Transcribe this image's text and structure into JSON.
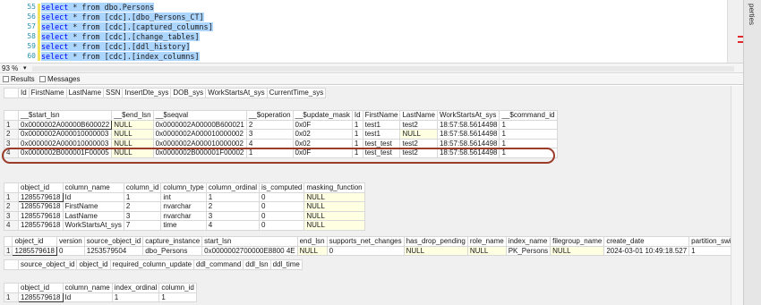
{
  "editor": {
    "lines": [
      {
        "num": "55",
        "kw": "select",
        "rest": " * from dbo.Persons"
      },
      {
        "num": "56",
        "kw": "select",
        "rest": " * from [cdc].[dbo_Persons_CT]"
      },
      {
        "num": "57",
        "kw": "select",
        "rest": " * from [cdc].[captured_columns]"
      },
      {
        "num": "58",
        "kw": "select",
        "rest": " * from [cdc].[change_tables]"
      },
      {
        "num": "59",
        "kw": "select",
        "rest": " * from [cdc].[ddl_history]"
      },
      {
        "num": "60",
        "kw": "select",
        "rest": " * from [cdc].[index_columns]"
      }
    ],
    "zoom": "93 %"
  },
  "tabs": {
    "results": "Results",
    "messages": "Messages"
  },
  "side_panel": {
    "label": "perties"
  },
  "grid1": {
    "headers": [
      "Id",
      "FirstName",
      "LastName",
      "SSN",
      "InsertDte_sys",
      "DOB_sys",
      "WorkStartsAt_sys",
      "CurrentTime_sys"
    ]
  },
  "grid2": {
    "headers": [
      "__$start_lsn",
      "__$end_lsn",
      "__$seqval",
      "__$operation",
      "__$update_mask",
      "Id",
      "FirstName",
      "LastName",
      "WorkStartsAt_sys",
      "__$command_id"
    ],
    "rows": [
      [
        "1",
        "0x0000002A00000B600022",
        "NULL",
        "0x0000002A00000B600021",
        "2",
        "0x0F",
        "1",
        "test1",
        "test2",
        "18:57:58.5614498",
        "1"
      ],
      [
        "2",
        "0x0000002A000010000003",
        "NULL",
        "0x0000002A000010000002",
        "3",
        "0x02",
        "1",
        "test1",
        "NULL",
        "18:57:58.5614498",
        "1"
      ],
      [
        "3",
        "0x0000002A000010000003",
        "NULL",
        "0x0000002A000010000002",
        "4",
        "0x02",
        "1",
        "test_test",
        "test2",
        "18:57:58.5614498",
        "1"
      ],
      [
        "4",
        "0x0000002B000001F00005",
        "NULL",
        "0x0000002B000001F00002",
        "1",
        "0x0F",
        "1",
        "test_test",
        "test2",
        "18:57:58.5614498",
        "1"
      ]
    ]
  },
  "grid3": {
    "headers": [
      "object_id",
      "column_name",
      "column_id",
      "column_type",
      "column_ordinal",
      "is_computed",
      "masking_function"
    ],
    "rows": [
      [
        "1",
        "1285579618",
        "Id",
        "1",
        "int",
        "1",
        "0",
        "NULL"
      ],
      [
        "2",
        "1285579618",
        "FirstName",
        "2",
        "nvarchar",
        "2",
        "0",
        "NULL"
      ],
      [
        "3",
        "1285579618",
        "LastName",
        "3",
        "nvarchar",
        "3",
        "0",
        "NULL"
      ],
      [
        "4",
        "1285579618",
        "WorkStartsAt_sys",
        "7",
        "time",
        "4",
        "0",
        "NULL"
      ]
    ]
  },
  "grid4": {
    "headers": [
      "object_id",
      "version",
      "source_object_id",
      "capture_instance",
      "start_lsn",
      "end_lsn",
      "supports_net_changes",
      "has_drop_pending",
      "role_name",
      "index_name",
      "filegroup_name",
      "create_date",
      "partition_switch"
    ],
    "rows": [
      [
        "1",
        "1285579618",
        "0",
        "1253579504",
        "dbo_Persons",
        "0x0000002700000E8800 4E",
        "NULL",
        "0",
        "NULL",
        "NULL",
        "PK_Persons",
        "NULL",
        "2024-03-01 10:49:18.527",
        "1"
      ]
    ]
  },
  "grid5": {
    "headers": [
      "source_object_id",
      "object_id",
      "required_column_update",
      "ddl_command",
      "ddl_lsn",
      "ddl_time"
    ]
  },
  "grid6": {
    "headers": [
      "object_id",
      "column_name",
      "index_ordinal",
      "column_id"
    ],
    "rows": [
      [
        "1",
        "1285579618",
        "Id",
        "1",
        "1"
      ]
    ]
  }
}
